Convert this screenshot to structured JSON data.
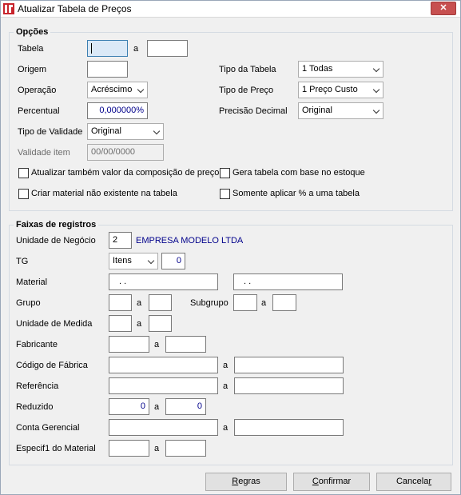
{
  "window": {
    "title": "Atualizar Tabela de Preços",
    "close_label": "✕"
  },
  "opcoes": {
    "title": "Opções",
    "tabela_label": "Tabela",
    "tabela_from": "",
    "tabela_a": "a",
    "tabela_to": "",
    "origem_label": "Origem",
    "origem_value": "",
    "operacao_label": "Operação",
    "operacao_value": "Acréscimo",
    "percentual_label": "Percentual",
    "percentual_value": "0,000000%",
    "tipo_validade_label": "Tipo de Validade",
    "tipo_validade_value": "Original",
    "validade_item_label": "Validade item",
    "validade_item_value": "00/00/0000",
    "tipo_tabela_label": "Tipo da Tabela",
    "tipo_tabela_value": "1 Todas",
    "tipo_preco_label": "Tipo de Preço",
    "tipo_preco_value": "1 Preço Custo",
    "precisao_label": "Precisão Decimal",
    "precisao_value": "Original",
    "checks": {
      "atualizar_composicao": "Atualizar também valor da composição de preços",
      "gera_estoque": "Gera tabela com base no estoque",
      "criar_material": "Criar material não existente na tabela",
      "somente_aplicar": "Somente aplicar % a uma tabela"
    }
  },
  "faixas": {
    "title": "Faixas de registros",
    "unidade_negocio_label": "Unidade de Negócio",
    "unidade_negocio_code": "2",
    "unidade_negocio_name": "EMPRESA MODELO LTDA",
    "tg_label": "TG",
    "tg_select": "Itens",
    "tg_value": "0",
    "material_label": "Material",
    "material_from": ". .",
    "material_to": ". .",
    "grupo_label": "Grupo",
    "subgrupo_label": "Subgrupo",
    "unidade_medida_label": "Unidade de Medida",
    "fabricante_label": "Fabricante",
    "codigo_fabrica_label": "Código de Fábrica",
    "referencia_label": "Referência",
    "reduzido_label": "Reduzido",
    "reduzido_from": "0",
    "reduzido_to": "0",
    "conta_gerencial_label": "Conta Gerencial",
    "especif_label": "Especif1 do Material",
    "a": "a"
  },
  "buttons": {
    "regras_first": "R",
    "regras_rest": "egras",
    "confirmar_first": "C",
    "confirmar_rest": "onfirmar",
    "cancelar_first": "Cancela",
    "cancelar_rest": "r"
  }
}
